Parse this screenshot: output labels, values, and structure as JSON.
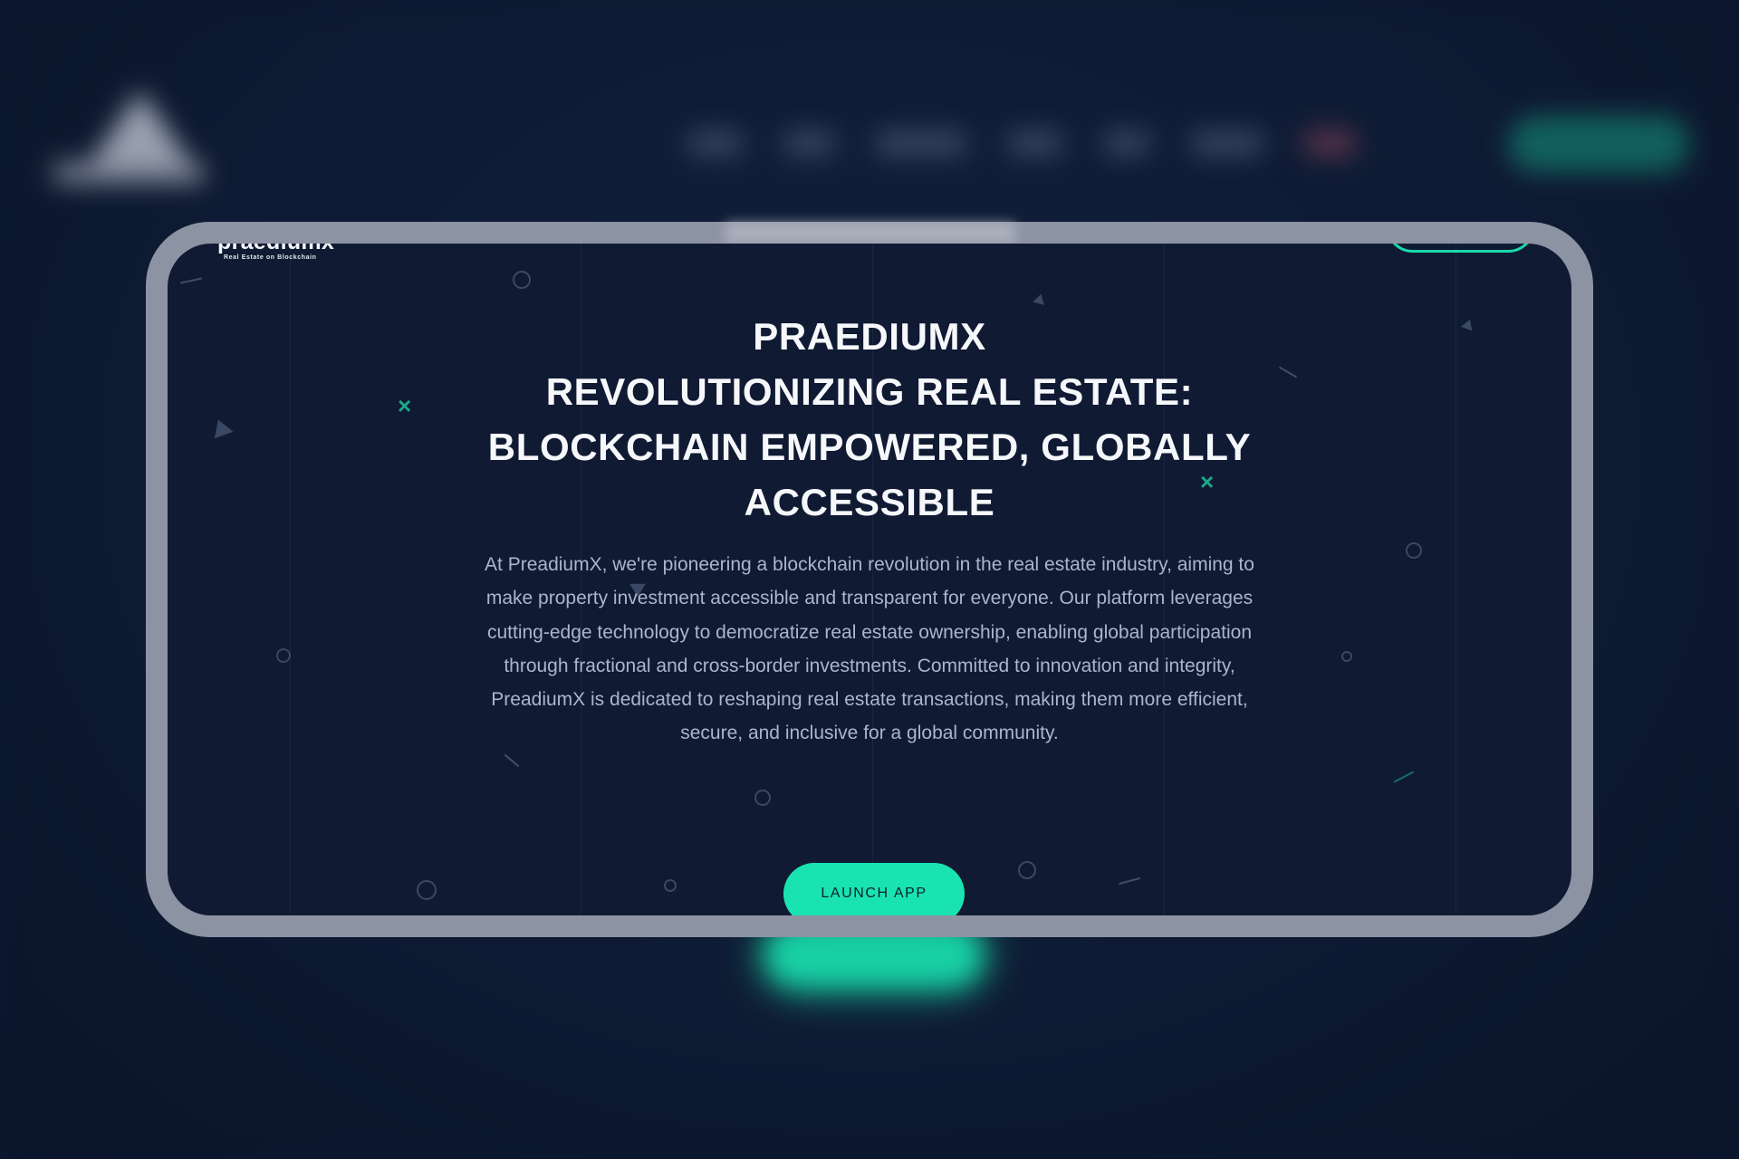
{
  "brand": {
    "name": "praediumx",
    "tagline": "Real Estate on Blockchain"
  },
  "hero": {
    "title_lines": [
      "PRAEDIUMX",
      "REVOLUTIONIZING REAL ESTATE:",
      "BLOCKCHAIN EMPOWERED, GLOBALLY",
      "ACCESSIBLE"
    ],
    "description": "At PreadiumX, we're pioneering a blockchain revolution in the real estate industry, aiming to make property investment accessible and transparent for everyone. Our platform leverages cutting-edge technology to democratize real estate ownership, enabling global participation through fractional and cross-border investments. Committed to innovation and integrity, PreadiumX is dedicated to reshaping real estate transactions, making them more efficient, secure, and inclusive for a global community.",
    "cta_label": "LAUNCH APP"
  },
  "colors": {
    "accent": "#19e4b1",
    "background": "#101a33",
    "frame": "#8c93a3",
    "text": "#f5f7fa",
    "muted_text": "#a9b6cc"
  },
  "icons": [
    "circle-icon",
    "triangle-icon",
    "cross-icon",
    "dash-icon"
  ]
}
